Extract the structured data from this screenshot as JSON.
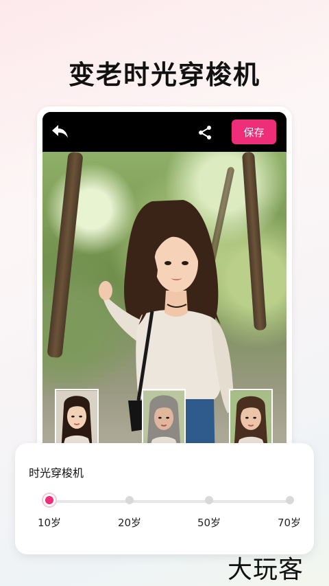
{
  "headline": "变老时光穿梭机",
  "topbar": {
    "back_icon": "back-arrow-icon",
    "share_icon": "share-icon",
    "save_label": "保存"
  },
  "thumbnails": [
    {
      "name": "young",
      "icon": "portrait-young-thumbnail"
    },
    {
      "name": "old",
      "icon": "portrait-old-thumbnail"
    },
    {
      "name": "middle",
      "icon": "portrait-middle-aged-thumbnail"
    }
  ],
  "panel": {
    "title": "时光穿梭机",
    "stops": [
      "10岁",
      "20岁",
      "50岁",
      "70岁"
    ],
    "selected_index": 0
  },
  "watermark": "大玩客",
  "colors": {
    "accent": "#ef2e7a",
    "topbar": "#000000"
  }
}
